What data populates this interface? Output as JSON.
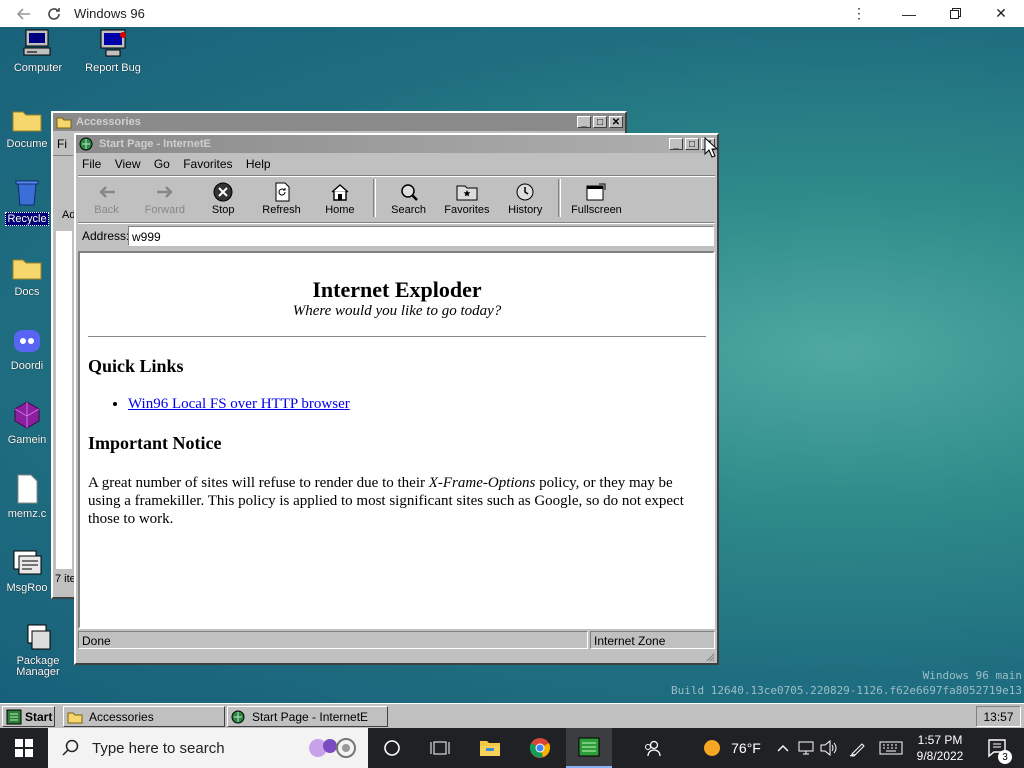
{
  "host": {
    "title": "Windows 96",
    "back_icon": "arrow-left-icon",
    "reload_icon": "reload-icon",
    "menu_icon": "more-vert-icon"
  },
  "desktop": {
    "icons": [
      {
        "label": "Computer",
        "icon": "computer-icon"
      },
      {
        "label": "Report Bug",
        "icon": "report-bug-icon"
      },
      {
        "label": "Docume",
        "icon": "folder-icon"
      },
      {
        "label": "Recycle",
        "icon": "recycle-bin-icon"
      },
      {
        "label": "Docs",
        "icon": "folder-icon"
      },
      {
        "label": "Doordi",
        "icon": "discord-icon"
      },
      {
        "label": "Gamein",
        "icon": "game-cube-icon"
      },
      {
        "label": "memz.c",
        "icon": "document-icon"
      },
      {
        "label": "MsgRoo",
        "icon": "message-room-icon"
      },
      {
        "label": "Package Manager",
        "icon": "package-manager-icon"
      }
    ],
    "build_line1": "Windows 96 main",
    "build_line2": "Build 12640.13ce0705.220829-1126.f62e6697fa8052719e13"
  },
  "accessories": {
    "title": "Accessories",
    "menu_fragment": "Fi",
    "toolbar_fragment": "Ad",
    "status_fragment": "7 ite"
  },
  "browser": {
    "title": "Start Page - InternetE",
    "menu": [
      "File",
      "View",
      "Go",
      "Favorites",
      "Help"
    ],
    "toolbar": [
      {
        "label": "Back",
        "icon": "arrow-left-icon",
        "enabled": false
      },
      {
        "label": "Forward",
        "icon": "arrow-right-icon",
        "enabled": false
      },
      {
        "label": "Stop",
        "icon": "stop-icon",
        "enabled": true
      },
      {
        "label": "Refresh",
        "icon": "refresh-icon",
        "enabled": true
      },
      {
        "label": "Home",
        "icon": "home-icon",
        "enabled": true
      },
      {
        "label": "Search",
        "icon": "search-icon",
        "enabled": true
      },
      {
        "label": "Favorites",
        "icon": "favorites-icon",
        "enabled": true
      },
      {
        "label": "History",
        "icon": "history-icon",
        "enabled": true
      },
      {
        "label": "Fullscreen",
        "icon": "fullscreen-icon",
        "enabled": true
      }
    ],
    "address_label": "Address:",
    "address_value": "w999",
    "status_left": "Done",
    "status_right": "Internet Zone",
    "page": {
      "heading": "Internet Exploder",
      "tagline": "Where would you like to go today?",
      "quick_links_heading": "Quick Links",
      "links": [
        "Win96 Local FS over HTTP browser"
      ],
      "notice_heading": "Important Notice",
      "notice_before": "A great number of sites will refuse to render due to their ",
      "notice_em": "X-Frame-Options",
      "notice_after": " policy, or they may be using a framekiller. This policy is applied to most significant sites such as Google, so do not expect those to work."
    }
  },
  "taskbar95": {
    "start": "Start",
    "tasks": [
      {
        "label": "Accessories",
        "icon": "folder-icon"
      },
      {
        "label": "Start Page - InternetE",
        "icon": "internet-exploder-icon"
      }
    ],
    "clock": "13:57"
  },
  "win10": {
    "search_placeholder": "Type here to search",
    "weather": "76°F",
    "time": "1:57 PM",
    "date": "9/8/2022",
    "notification_count": "3"
  },
  "colors": {
    "title_active_start": "#000080",
    "title_active_end": "#1084d0",
    "title_inactive": "#8a8a8a",
    "desktop_teal": "#2f8c8a",
    "win10_bar": "#202124"
  }
}
